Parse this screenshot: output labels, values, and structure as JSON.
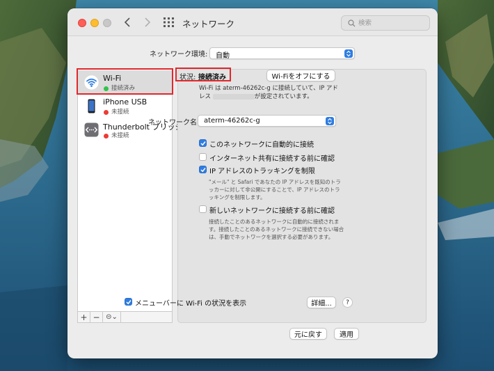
{
  "window": {
    "title": "ネットワーク",
    "search_placeholder": "検索"
  },
  "location": {
    "label": "ネットワーク環境:",
    "value": "自動"
  },
  "services": [
    {
      "name": "Wi-Fi",
      "status": "接続済み",
      "status_color": "#32c24d"
    },
    {
      "name": "iPhone USB",
      "status": "未接続",
      "status_color": "#ec3c35"
    },
    {
      "name": "Thunderbolt ブリッジ",
      "status": "未接続",
      "status_color": "#ec3c35"
    }
  ],
  "sidebar_tools": {
    "add": "+",
    "remove": "−",
    "gear": "⊝⌄"
  },
  "status": {
    "label": "状況:",
    "value": "接続済み",
    "turn_off_button": "Wi-Fiをオフにする",
    "desc_line1": "Wi-Fi は aterm-46262c-g に接続していて、IP アド",
    "desc_line2_prefix": "レス",
    "desc_line2_suffix": "が設定されています。"
  },
  "network_name": {
    "label": "ネットワーク名:",
    "value": "aterm-46262c-g"
  },
  "options": [
    {
      "label": "このネットワークに自動的に接続",
      "checked": true
    },
    {
      "label": "インターネット共有に接続する前に確認",
      "checked": false
    },
    {
      "label": "IP アドレスのトラッキングを制限",
      "checked": true,
      "help": "\"メール\" と Safari であなたの IP アドレスを既知のトラッカーに対して非公開にすることで、IP アドレスのトラッキングを制限します。"
    },
    {
      "label": "新しいネットワークに接続する前に確認",
      "checked": false,
      "help": "接続したことのあるネットワークに自動的に接続されます。接続したことのあるネットワークに接続できない場合は、手動でネットワークを選択する必要があります。"
    }
  ],
  "menubar_option": {
    "label": "メニューバーに Wi-Fi の状況を表示",
    "checked": true
  },
  "buttons": {
    "details": "詳細...",
    "help": "?",
    "revert": "元に戻す",
    "apply": "適用"
  },
  "colors": {
    "accent": "#2f7de1",
    "highlight_box": "#e0272b"
  }
}
